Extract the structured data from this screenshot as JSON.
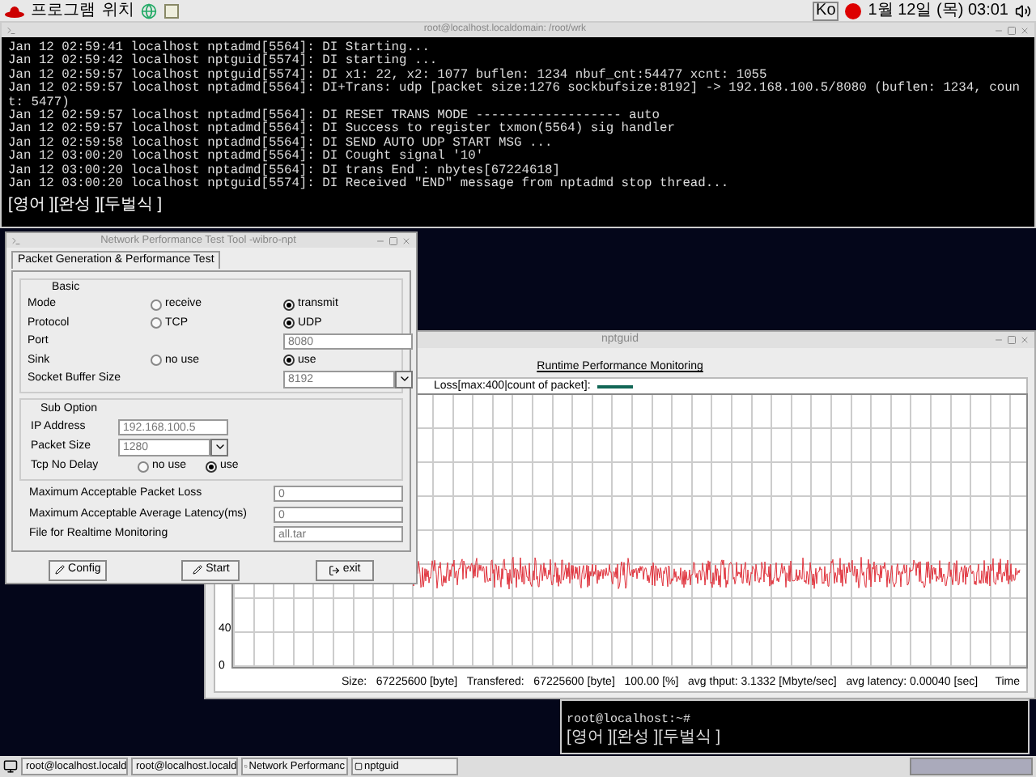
{
  "top_panel": {
    "menus": [
      "프로그램",
      "위치"
    ],
    "input_method": "Ko",
    "clock": "1월 12일 (목) 03:01"
  },
  "terminal": {
    "title": "root@localhost.localdomain: /root/wrk",
    "lines": [
      "Jan 12 02:59:41 localhost nptadmd[5564]: DI Starting...",
      "Jan 12 02:59:42 localhost nptguid[5574]: DI starting ...",
      "Jan 12 02:59:57 localhost nptguid[5574]: DI x1: 22, x2: 1077 buflen: 1234 nbuf_cnt:54477 xcnt: 1055",
      "Jan 12 02:59:57 localhost nptadmd[5564]: DI+Trans: udp [packet size:1276 sockbufsize:8192] -> 192.168.100.5/8080 (buflen: 1234, count: 5477)",
      "Jan 12 02:59:57 localhost nptadmd[5564]: DI RESET TRANS MODE ------------------- auto",
      "Jan 12 02:59:57 localhost nptadmd[5564]: DI Success to register txmon(5564) sig handler",
      "Jan 12 02:59:58 localhost nptadmd[5564]: DI SEND AUTO UDP START MSG ...",
      "Jan 12 03:00:20 localhost nptadmd[5564]: DI Cought signal '10'",
      "Jan 12 03:00:20 localhost nptadmd[5564]: DI trans End : nbytes[67224618]",
      "Jan 12 03:00:20 localhost nptguid[5574]: DI Received \"END\" message from nptadmd stop thread..."
    ],
    "ime_status": "[영어 ][완성 ][두벌식 ]"
  },
  "dialog": {
    "title": "Network Performance Test Tool -wibro-npt",
    "tab": "Packet Generation & Performance Test",
    "basic": {
      "title": "Basic",
      "rows": [
        {
          "kind": "radio",
          "label": "Mode",
          "options": [
            {
              "label": "receive",
              "selected": false
            },
            {
              "label": "transmit",
              "selected": true
            }
          ]
        },
        {
          "kind": "radio",
          "label": "Protocol",
          "options": [
            {
              "label": "TCP",
              "selected": false
            },
            {
              "label": "UDP",
              "selected": true
            }
          ]
        },
        {
          "kind": "text",
          "label": "Port",
          "value": "8080"
        },
        {
          "kind": "radio",
          "label": "Sink",
          "options": [
            {
              "label": "no use",
              "selected": false
            },
            {
              "label": "use",
              "selected": true
            }
          ]
        },
        {
          "kind": "select",
          "label": "Socket Buffer Size",
          "value": "8192"
        }
      ]
    },
    "sub_option": {
      "title": "Sub Option",
      "rows": [
        {
          "kind": "text",
          "label": "IP Address",
          "value": "192.168.100.5"
        },
        {
          "kind": "select",
          "label": "Packet Size",
          "value": "1280"
        },
        {
          "kind": "radio",
          "label": "Tcp No Delay",
          "options": [
            {
              "label": "no use",
              "selected": false
            },
            {
              "label": "use",
              "selected": true
            }
          ]
        }
      ]
    },
    "fields": [
      {
        "label": "Maximum Acceptable Packet Loss",
        "value": "0"
      },
      {
        "label": "Maximum Acceptable Average Latency(ms)",
        "value": "0"
      },
      {
        "label": "File for Realtime Monitoring",
        "value": "all.tar"
      }
    ],
    "buttons": [
      {
        "kind": "pencil",
        "label": "Config"
      },
      {
        "kind": "pencil",
        "label": "Start"
      },
      {
        "kind": "exit",
        "label": "exit"
      }
    ]
  },
  "monitor": {
    "title": "nptguid",
    "heading": "Runtime Performance Monitoring",
    "legend": "Loss[max:400|count of packet]:",
    "axis_labels": [
      "40",
      "0"
    ],
    "x_label": "Time",
    "status": "Size:   67225600 [byte]   Transfered:   67225600 [byte]   100.00 [%]   avg thput: 3.1332 [Mbyte/sec]   avg latency: 0.00040 [sec]"
  },
  "terminal_2": {
    "prompt": "root@localhost:~#",
    "ime_status": "[영어 ][완성 ][두벌식 ]"
  },
  "taskbar": {
    "tasks": [
      "root@localhost.locald",
      "root@localhost.locald",
      "Network Performanc",
      "nptguid"
    ]
  }
}
